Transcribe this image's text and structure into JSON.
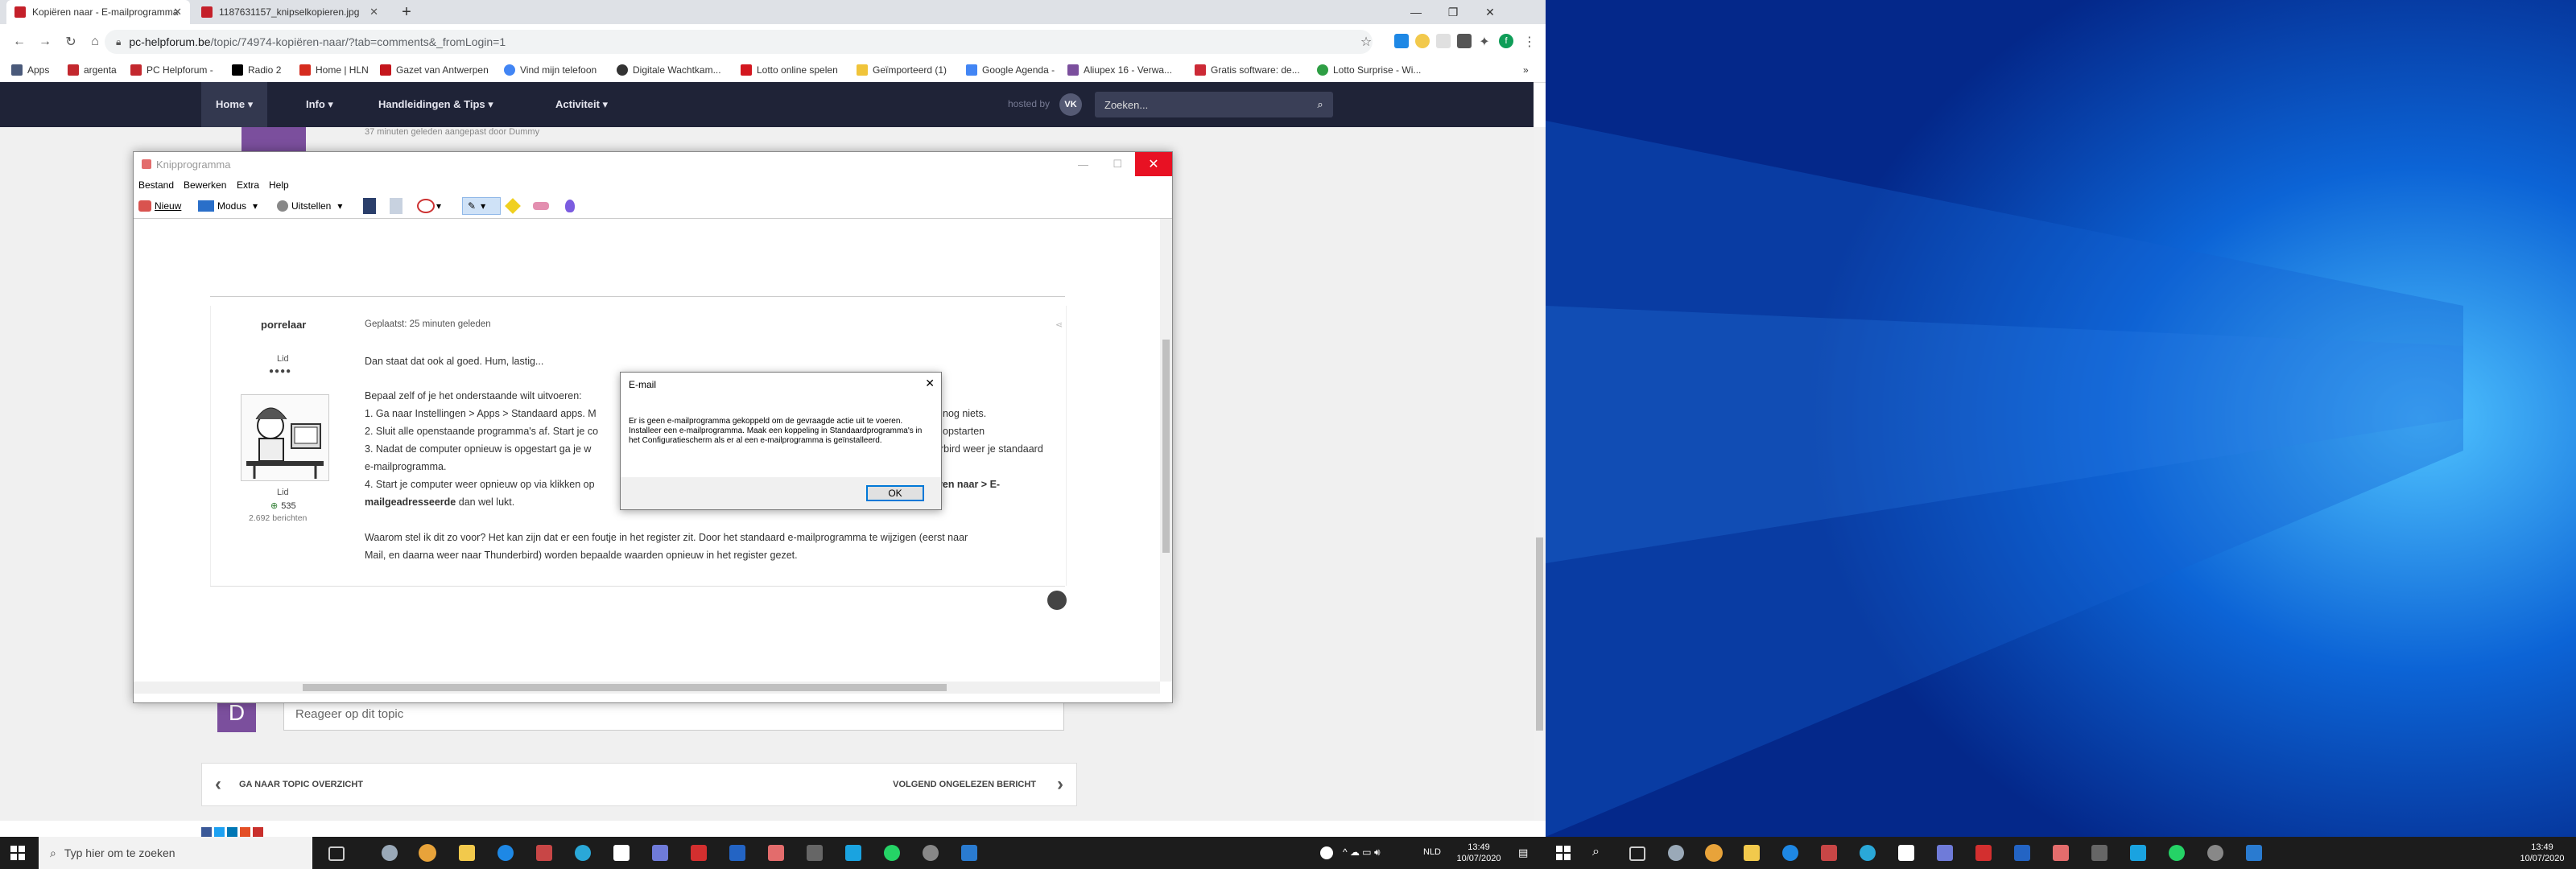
{
  "browser": {
    "tabs": [
      {
        "title": "Kopiëren naar - E-mailprogramma",
        "active": true
      },
      {
        "title": "1187631157_knipselkopieren.jpg",
        "active": false
      }
    ],
    "url_host": "pc-helpforum.be",
    "url_path": "/topic/74974-kopiëren-naar/?tab=comments&_fromLogin=1",
    "profile_initial": "f"
  },
  "bookmarks": [
    {
      "label": "Apps",
      "color": "#4a5a7a"
    },
    {
      "label": "argenta",
      "color": "#c3282e"
    },
    {
      "label": "PC Helpforum -",
      "color": "#c3282e"
    },
    {
      "label": "Radio 2",
      "color": "#000000"
    },
    {
      "label": "Home | HLN",
      "color": "#d52b1e"
    },
    {
      "label": "Gazet van Antwerpen",
      "color": "#c4161c"
    },
    {
      "label": "Vind mijn telefoon",
      "color": "#4285f4"
    },
    {
      "label": "Digitale Wachtkam...",
      "color": "#333333"
    },
    {
      "label": "Lotto online spelen",
      "color": "#d3171f"
    },
    {
      "label": "Geïmporteerd (1)",
      "color": "#f0c43a"
    },
    {
      "label": "Google Agenda -",
      "color": "#4285f4"
    },
    {
      "label": "Aliupex 16 - Verwa...",
      "color": "#7b4f9d"
    },
    {
      "label": "Gratis software: de...",
      "color": "#cc2a36"
    },
    {
      "label": "Lotto Surprise - Wi...",
      "color": "#2e9e44"
    }
  ],
  "site": {
    "nav": [
      "Home ▾",
      "Info ▾",
      "Handleidingen & Tips ▾",
      "Activiteit ▾"
    ],
    "hosted": "hosted by",
    "search_placeholder": "Zoeken...",
    "reply_placeholder": "Reageer op dit topic",
    "avatar_letter": "D",
    "prev_topic": "GA NAAR TOPIC OVERZICHT",
    "next_topic": "VOLGEND ONGELEZEN BERICHT",
    "last_post_note": "37 minuten geleden aangepast door Dummy"
  },
  "snip": {
    "title": "Knipprogramma",
    "menu": [
      "Bestand",
      "Bewerken",
      "Extra",
      "Help"
    ],
    "tools": {
      "new": "Nieuw",
      "mode": "Modus",
      "delay": "Uitstellen"
    },
    "post": {
      "author": "porrelaar",
      "role_top": "Lid",
      "role_bottom": "Lid",
      "reputation": "535",
      "post_count": "2.692 berichten",
      "posted": "Geplaatst: 25 minuten geleden",
      "lines": [
        "Dan staat dat ook al goed. Hum, lastig...",
        "Bepaal zelf of je het onderstaande wilt uitvoeren:",
        "1. Ga naar Instellingen > Apps > Standaard apps. M",
        "2. Sluit alle openstaande programma's af. Start je co",
        "3. Nadat de computer opnieuw is opgestart ga je w",
        "e-mailprogramma.",
        "4. Start je computer weer opnieuw op via klikken op",
        "Waarom stel ik dit zo voor? Het kan zijn dat er een foutje in het register zit. Door het standaard e-mailprogramma te wijzigen (eerst naar",
        "Mail, en daarna weer naar Thunderbird) worden bepaalde waarden opnieuw in het register gezet."
      ],
      "right_fragments": [
        "nog niets.",
        "opstarten",
        "erbird weer je standaard",
        "ren naar > E-"
      ],
      "bold_start": "mailgeadresseerde",
      "bold_tail": " dan wel lukt."
    }
  },
  "dialog": {
    "title": "E-mail",
    "message": "Er is geen e-mailprogramma gekoppeld om de gevraagde actie uit te voeren. Installeer een e-mailprogramma. Maak een koppeling in Standaardprogramma's in het Configuratiescherm als er al een e-mailprogramma is geïnstalleerd.",
    "ok": "OK"
  },
  "taskbar": {
    "search_placeholder": "Typ hier om te zoeken",
    "lang": "NLD",
    "time": "13:49",
    "date": "10/07/2020"
  }
}
